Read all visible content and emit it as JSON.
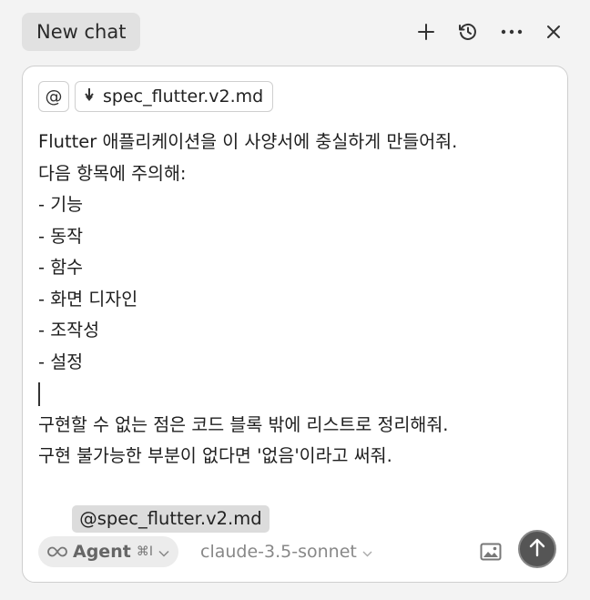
{
  "header": {
    "tab_label": "New chat",
    "icons": [
      "plus-icon",
      "history-icon",
      "more-icon",
      "close-icon"
    ]
  },
  "composer": {
    "at_symbol": "@",
    "context_file": "spec_flutter.v2.md",
    "lines": [
      "Flutter 애플리케이션을 이 사양서에 충실하게 만들어줘.",
      "다음 항목에 주의해:",
      "- 기능",
      "- 동작",
      "- 함수",
      "- 화면 디자인",
      "- 조작성",
      "- 설정",
      "",
      "구현할 수 없는 점은 코드 블록 밖에 리스트로 정리해줘.",
      "구현 불가능한 부분이 없다면 '없음'이라고 써줘."
    ],
    "mention": "@spec_flutter.v2.md"
  },
  "footer": {
    "mode_label": "Agent",
    "mode_shortcut": "⌘I",
    "model": "claude-3.5-sonnet"
  }
}
